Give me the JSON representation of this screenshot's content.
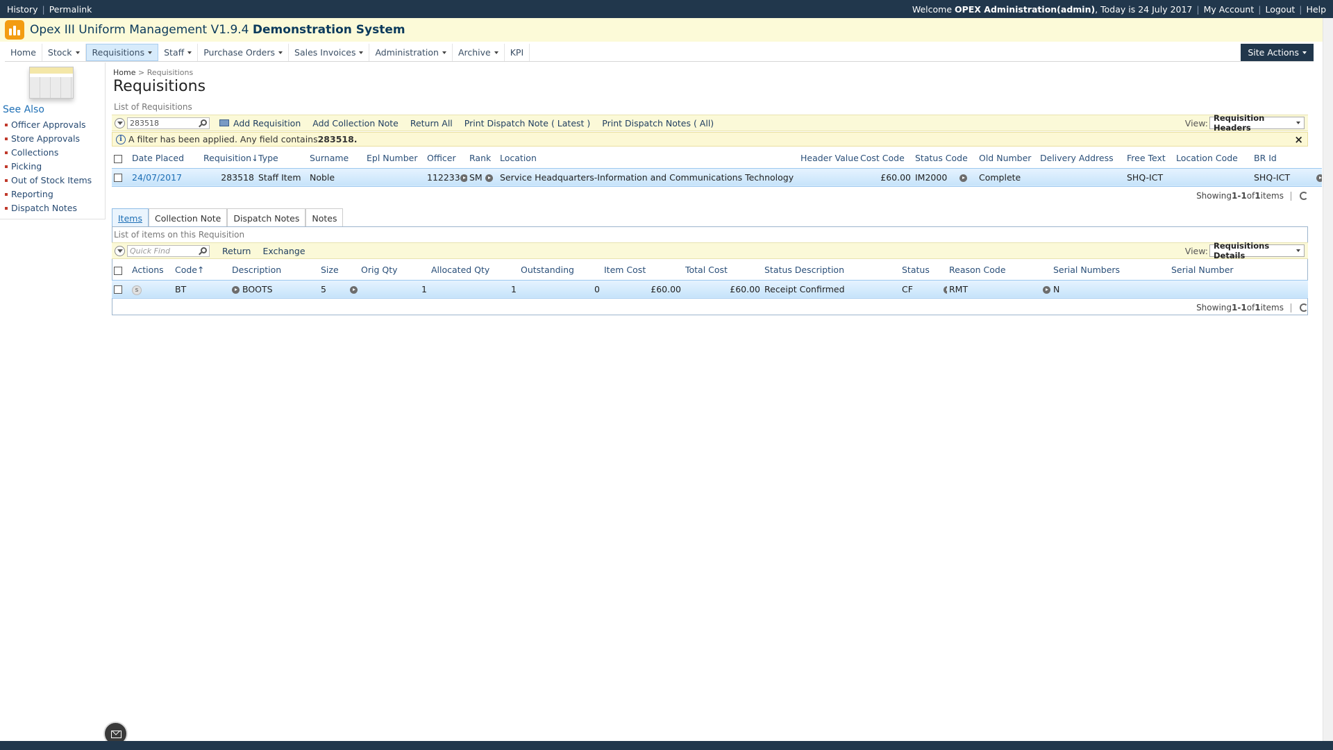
{
  "topbar": {
    "history": "History",
    "permalink": "Permalink",
    "welcome_prefix": "Welcome ",
    "user": "OPEX Administration(admin)",
    "today": ", Today is 24 July 2017",
    "my_account": "My Account",
    "logout": "Logout",
    "help": "Help"
  },
  "app": {
    "title": "Opex III Uniform Management V1.9.4",
    "title_bold": "Demonstration System",
    "logo_color": "#f39c12"
  },
  "nav": {
    "home": "Home",
    "stock": "Stock",
    "requisitions": "Requisitions",
    "staff": "Staff",
    "purchase_orders": "Purchase Orders",
    "sales_invoices": "Sales Invoices",
    "administration": "Administration",
    "archive": "Archive",
    "kpi": "KPI",
    "site_actions": "Site Actions"
  },
  "sidebar": {
    "see_also": "See Also",
    "items": [
      "Officer Approvals",
      "Store Approvals",
      "Collections",
      "Picking",
      "Out of Stock Items",
      "Reporting",
      "Dispatch Notes"
    ]
  },
  "breadcrumb": {
    "home": "Home",
    "separator": ">",
    "current": "Requisitions"
  },
  "page_title": "Requisitions",
  "headers_list": {
    "label": "List of Requisitions",
    "search_value": "283518",
    "add_requisition": "Add Requisition",
    "add_collection_note": "Add Collection Note",
    "return_all": "Return All",
    "print_latest": "Print Dispatch Note ( Latest )",
    "print_all": "Print Dispatch Notes ( All)",
    "view_label": "View:",
    "view_value": "Requisition Headers",
    "filter_text": "A filter has been applied. Any field contains ",
    "filter_value": "283518.",
    "columns": [
      "Date Placed",
      "Requisition",
      "Type",
      "Surname",
      "Epl Number",
      "Officer",
      "Rank",
      "Location",
      "Header Value",
      "Cost Code",
      "Status Code",
      "Old Number",
      "Delivery Address",
      "Free Text",
      "Location Code",
      "BR Id"
    ],
    "row": {
      "date": "24/07/2017",
      "requisition": "283518",
      "type": "Staff Item",
      "surname": "Noble",
      "epl": "",
      "officer": "112233",
      "rank": "SM",
      "location": "Service Headquarters-Information and Communications Technology",
      "header_value": "£60.00",
      "cost_code": "IM2000",
      "status_code": "Complete",
      "old_number": "",
      "delivery_address": "SHQ-ICT",
      "free_text": "",
      "location_code": "SHQ-ICT",
      "br_id": ""
    },
    "showing_prefix": "Showing ",
    "showing_range": "1-1",
    "showing_of": " of ",
    "showing_total": "1",
    "showing_suffix": " items"
  },
  "tabs": [
    "Items",
    "Collection Note",
    "Dispatch Notes",
    "Notes"
  ],
  "items_list": {
    "label": "List of items on this Requisition",
    "search_placeholder": "Quick Find",
    "return": "Return",
    "exchange": "Exchange",
    "view_label": "View:",
    "view_value": "Requisitions Details",
    "columns": [
      "Actions",
      "Code",
      "Description",
      "Size",
      "Orig Qty",
      "Allocated Qty",
      "Outstanding",
      "Item Cost",
      "Total Cost",
      "Status Description",
      "Status",
      "Reason Code",
      "Serial Numbers",
      "Serial Number"
    ],
    "row": {
      "action": "s",
      "code": "BT",
      "description": "BOOTS",
      "size": "5",
      "orig_qty": "1",
      "allocated_qty": "1",
      "outstanding": "0",
      "item_cost": "£60.00",
      "total_cost": "£60.00",
      "status_description": "Receipt Confirmed",
      "status": "CF",
      "reason_code": "RMT",
      "serial_numbers": "N",
      "serial_number": ""
    },
    "showing_prefix": "Showing ",
    "showing_range": "1-1",
    "showing_of": " of ",
    "showing_total": "1",
    "showing_suffix": " items"
  }
}
